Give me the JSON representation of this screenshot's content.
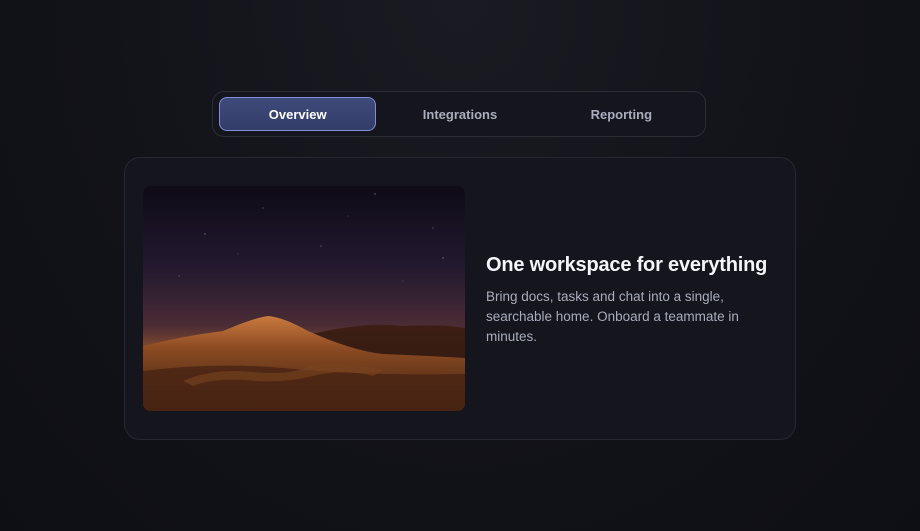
{
  "tabs": [
    {
      "label": "Overview",
      "active": true
    },
    {
      "label": "Integrations",
      "active": false
    },
    {
      "label": "Reporting",
      "active": false
    }
  ],
  "feature": {
    "title": "One workspace for everything",
    "description": "Bring docs, tasks and chat into a single, searchable home. Onboard a teammate in minutes."
  },
  "colors": {
    "accent": "#7f8fd6",
    "active_tab_bg": "#3a4574",
    "background": "#121319"
  }
}
